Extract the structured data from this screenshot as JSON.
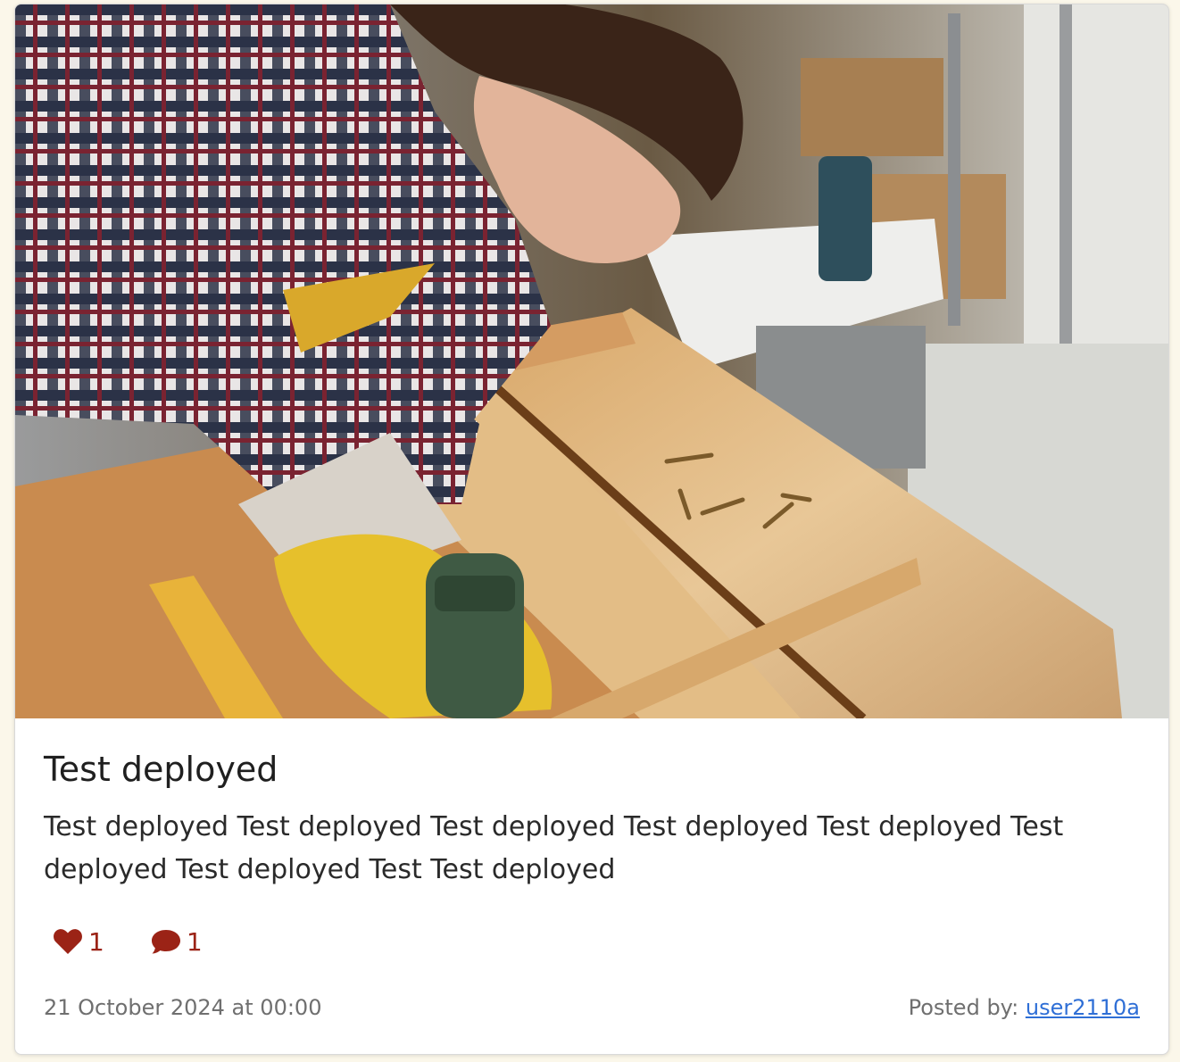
{
  "post": {
    "image_description": "woman-drilling-wooden-crate",
    "title": "Test deployed",
    "description": "Test deployed Test deployed Test deployed Test deployed Test deployed Test deployed Test deployed Test Test deployed",
    "likes": "1",
    "comments": "1",
    "date": "21 October 2024 at 00:00",
    "posted_by_label": "Posted by:",
    "author": "user2110a"
  },
  "icons": {
    "like": "heart-icon",
    "comment": "speech-bubble-icon"
  },
  "colors": {
    "page_background": "#fbf7ea",
    "card_background": "#ffffff",
    "accent_red": "#9b2316",
    "link_blue": "#2f6fd6",
    "muted_text": "#6f6f6f"
  }
}
